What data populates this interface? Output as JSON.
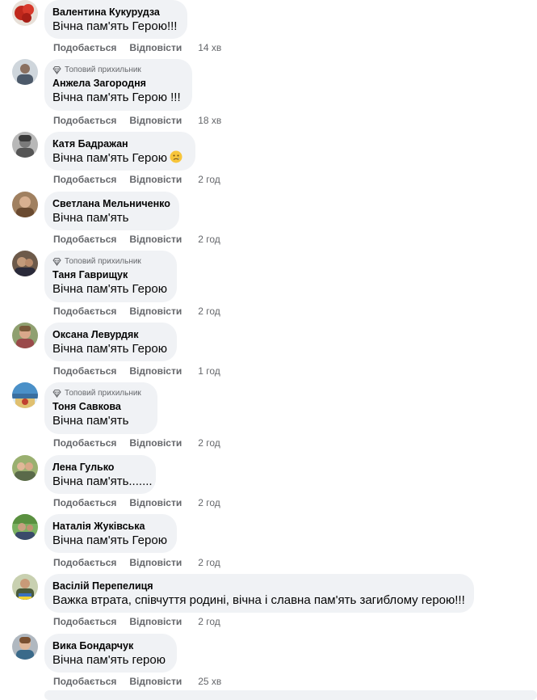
{
  "actions": {
    "like": "Подобається",
    "reply": "Відповісти"
  },
  "badge_label": "Топовий прихильник",
  "icons": {
    "badge": "diamond-icon",
    "sad_emoji": "sad-face-icon"
  },
  "colors": {
    "bubble": "#f0f2f5",
    "secondary_text": "#65676b",
    "primary_text": "#050505"
  },
  "comments": [
    {
      "author": "Валентина Кукурудза",
      "text": "Вічна пам'ять Герою!!!",
      "time": "14 хв",
      "top_fan": false
    },
    {
      "author": "Анжела Загородня",
      "text": "Вічна пам'ять Герою !!!",
      "time": "18 хв",
      "top_fan": true
    },
    {
      "author": "Катя Бадражан",
      "text": "Вічна пам'ять Герою",
      "time": "2 год",
      "top_fan": false,
      "emoji": "sad-face-icon"
    },
    {
      "author": "Светлана Мельниченко",
      "text": "Вічна пам'ять",
      "time": "2 год",
      "top_fan": false
    },
    {
      "author": "Таня Гаврищук",
      "text": "Вічна пам'ять Герою",
      "time": "2 год",
      "top_fan": true
    },
    {
      "author": "Оксана Левурдяк",
      "text": "Вічна пам'ять Герою",
      "time": "1 год",
      "top_fan": false
    },
    {
      "author": "Тоня Савкова",
      "text": "Вічна пам'ять",
      "time": "2 год",
      "top_fan": true
    },
    {
      "author": "Лена Гулько",
      "text": "Вічна пам'ять.......",
      "time": "2 год",
      "top_fan": false
    },
    {
      "author": "Наталія Жуківська",
      "text": "Вічна пам'ять Герою",
      "time": "2 год",
      "top_fan": false
    },
    {
      "author": "Васілій Перепелиця",
      "text": "Важка втрата, співчуття родині, вічна і славна пам'ять загиблому герою!!!",
      "time": "2 год",
      "top_fan": false
    },
    {
      "author": "Вика Бондарчук",
      "text": "Вічна пам'ять герою",
      "time": "25 хв",
      "top_fan": false
    }
  ]
}
